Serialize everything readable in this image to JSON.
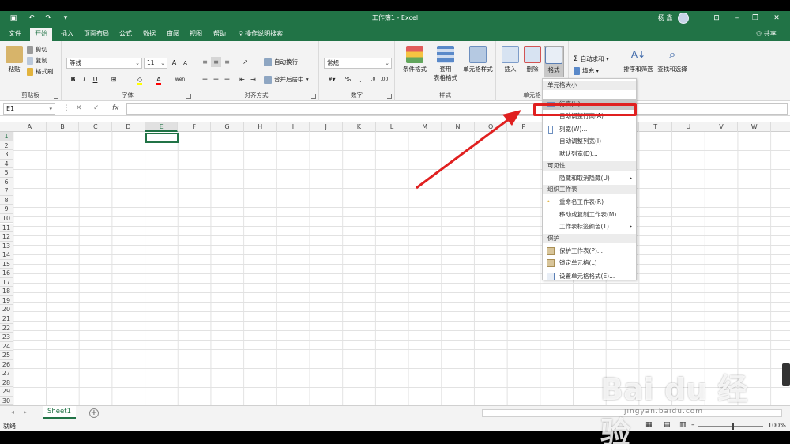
{
  "window": {
    "title": "工作簿1 - Excel",
    "user": "杨 鑫"
  },
  "tabs": [
    "文件",
    "开始",
    "插入",
    "页面布局",
    "公式",
    "数据",
    "审阅",
    "视图",
    "帮助"
  ],
  "active_tab": "开始",
  "tell_me": "操作说明搜索",
  "share": "共享",
  "ribbon": {
    "clipboard": {
      "paste": "粘贴",
      "cut": "剪切",
      "copy": "复制",
      "format_painter": "格式刷",
      "label": "剪贴板"
    },
    "font": {
      "name": "等线",
      "size": "11",
      "grow": "A",
      "shrink": "A",
      "bold": "B",
      "italic": "I",
      "underline": "U",
      "wen": "wén",
      "label": "字体"
    },
    "alignment": {
      "wrap": "自动换行",
      "merge": "合并后居中",
      "label": "对齐方式"
    },
    "number": {
      "format": "常规",
      "percent": "%",
      "comma": ",",
      "label": "数字"
    },
    "styles": {
      "conditional": "条件格式",
      "table_1": "套用",
      "table_2": "表格格式",
      "cell_styles": "单元格样式",
      "label": "样式"
    },
    "cells": {
      "insert": "插入",
      "delete": "删除",
      "format": "格式",
      "label": "单元格"
    },
    "editing": {
      "autosum": "自动求和",
      "fill": "填充",
      "clear": "清除",
      "sort": "排序和筛选",
      "find": "查找和选择"
    }
  },
  "formula_bar": {
    "name_box": "E1",
    "fx": "fx",
    "cancel": "✕",
    "enter": "✓"
  },
  "columns": [
    "A",
    "B",
    "C",
    "D",
    "E",
    "F",
    "G",
    "H",
    "I",
    "J",
    "K",
    "L",
    "M",
    "N",
    "O",
    "P",
    "Q",
    "R",
    "S",
    "T",
    "U",
    "V",
    "W"
  ],
  "rows": [
    "1",
    "2",
    "3",
    "4",
    "5",
    "6",
    "7",
    "8",
    "9",
    "10",
    "11",
    "12",
    "13",
    "14",
    "15",
    "16",
    "17",
    "18",
    "19",
    "20",
    "21",
    "22",
    "23",
    "24",
    "25",
    "26",
    "27",
    "28",
    "29",
    "30"
  ],
  "selected_cell": "E1",
  "sheet": {
    "name": "Sheet1",
    "add": "+"
  },
  "status": {
    "ready": "就绪",
    "zoom": "100%"
  },
  "menu": {
    "section_size": "单元格大小",
    "row_height": "行高(H)...",
    "autofit_row": "自动调整行高(A)",
    "col_width": "列宽(W)...",
    "autofit_col": "自动调整列宽(I)",
    "default_width": "默认列宽(D)...",
    "section_visibility": "可见性",
    "hide_unhide": "隐藏和取消隐藏(U)",
    "section_organize": "组织工作表",
    "rename": "重命名工作表(R)",
    "move_copy": "移动或复制工作表(M)...",
    "tab_color": "工作表标签颜色(T)",
    "section_protect": "保护",
    "protect_sheet": "保护工作表(P)...",
    "lock_cell": "锁定单元格(L)",
    "format_cells": "设置单元格格式(E)..."
  },
  "watermark": {
    "main": "Bai du 经验",
    "sub": "jingyan.baidu.com"
  },
  "colors": {
    "excel_green": "#217346",
    "highlight_red": "#e02020"
  }
}
